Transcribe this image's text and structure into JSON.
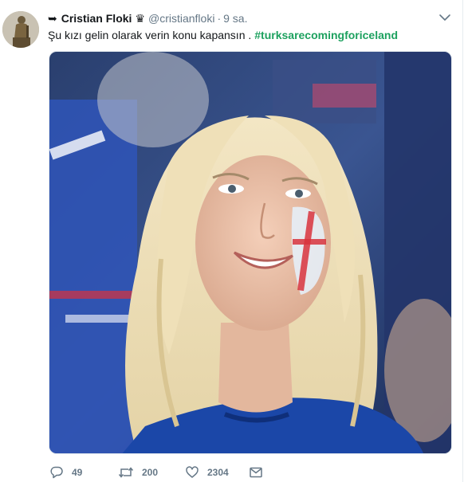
{
  "tweet": {
    "author_prefix_icon": "arrow-icon",
    "author_name": "Cristian Floki",
    "author_badge": "♛",
    "handle": "@cristianfloki",
    "separator": "·",
    "time": "9 sa.",
    "text": "Şu kızı gelin olarak verin konu kapansın .",
    "hashtag": "#turksarecomingforiceland",
    "hashtag_color": "#1da15f"
  },
  "actions": {
    "reply_count": "49",
    "retweet_count": "200",
    "like_count": "2304"
  },
  "colors": {
    "muted": "#657786",
    "text": "#14171a",
    "jersey_blue": "#1b47a8"
  }
}
